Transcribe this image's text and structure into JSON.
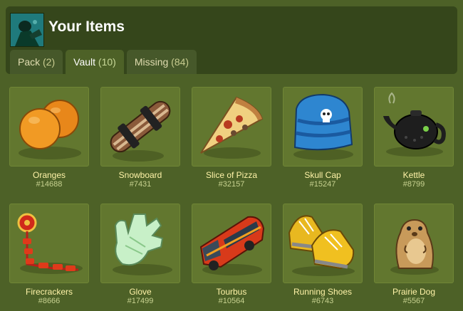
{
  "header": {
    "title": "Your Items"
  },
  "tabs": [
    {
      "label": "Pack",
      "count": "(2)"
    },
    {
      "label": "Vault",
      "count": "(10)",
      "active": true
    },
    {
      "label": "Missing",
      "count": "(84)"
    }
  ],
  "items": [
    {
      "name": "Oranges",
      "id": "#14688",
      "icon": "oranges-icon"
    },
    {
      "name": "Snowboard",
      "id": "#7431",
      "icon": "snowboard-icon"
    },
    {
      "name": "Slice of Pizza",
      "id": "#32157",
      "icon": "pizza-slice-icon"
    },
    {
      "name": "Skull Cap",
      "id": "#15247",
      "icon": "skull-cap-icon"
    },
    {
      "name": "Kettle",
      "id": "#8799",
      "icon": "kettle-icon"
    },
    {
      "name": "Firecrackers",
      "id": "#8666",
      "icon": "firecrackers-icon"
    },
    {
      "name": "Glove",
      "id": "#17499",
      "icon": "glove-icon"
    },
    {
      "name": "Tourbus",
      "id": "#10564",
      "icon": "tourbus-icon"
    },
    {
      "name": "Running Shoes",
      "id": "#6743",
      "icon": "running-shoes-icon"
    },
    {
      "name": "Prairie Dog",
      "id": "#5567",
      "icon": "prairie-dog-icon"
    }
  ]
}
